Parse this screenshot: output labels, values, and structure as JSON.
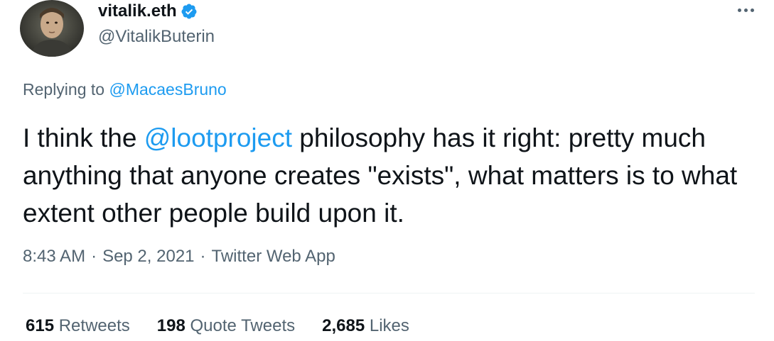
{
  "author": {
    "display_name": "vitalik.eth",
    "handle": "@VitalikButerin",
    "verified": true
  },
  "reply": {
    "prefix": "Replying to ",
    "to_handle": "@MacaesBruno"
  },
  "tweet": {
    "text_before_mention": "I think the ",
    "mention": "@lootproject",
    "text_after_mention": " philosophy has it right: pretty much anything that anyone creates \"exists\", what matters is to what extent other people build upon it."
  },
  "meta": {
    "time": "8:43 AM",
    "separator": "·",
    "date": "Sep 2, 2021",
    "source": "Twitter Web App"
  },
  "stats": {
    "retweets_count": "615",
    "retweets_label": "Retweets",
    "quote_count": "198",
    "quote_label": "Quote Tweets",
    "likes_count": "2,685",
    "likes_label": "Likes"
  },
  "colors": {
    "link": "#1d9bf0",
    "secondary_text": "#536471",
    "primary_text": "#0f1419",
    "verified_badge": "#1d9bf0"
  },
  "icons": {
    "verified": "verified-badge-icon",
    "more": "more-options-icon"
  }
}
